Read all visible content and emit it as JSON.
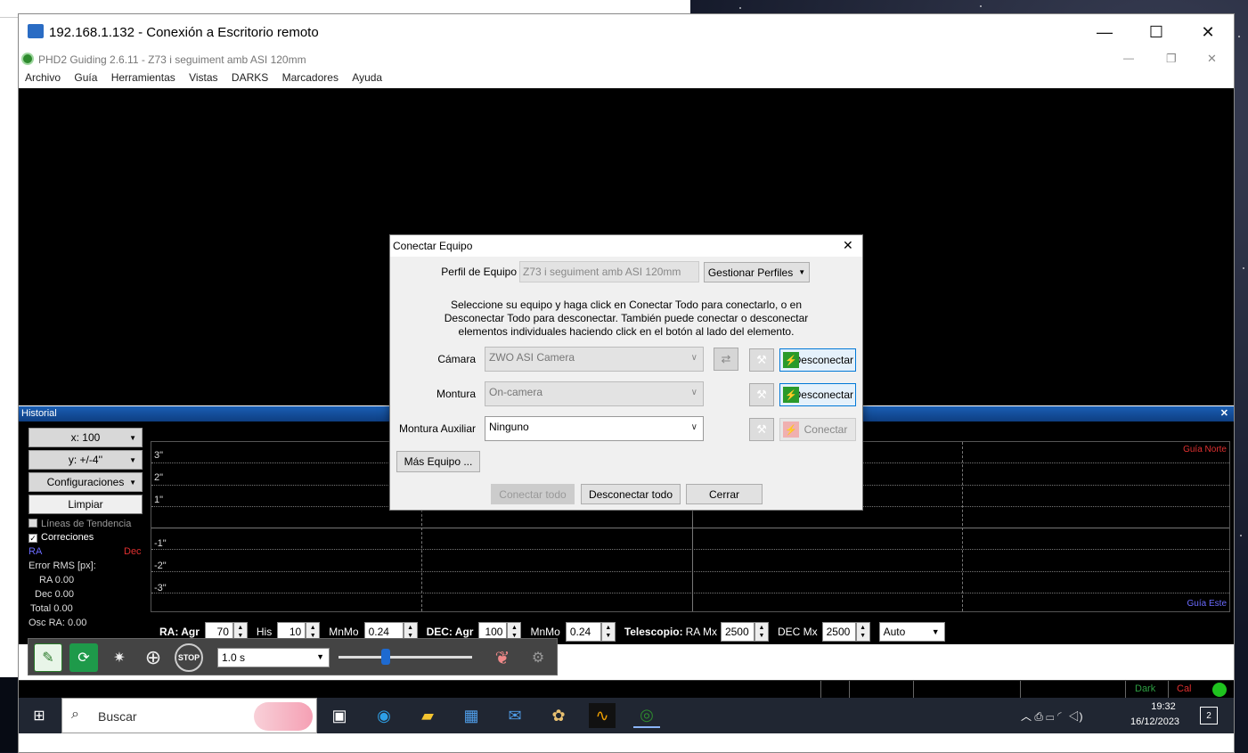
{
  "rdp": {
    "title": "192.168.1.132 - Conexión a Escritorio remoto",
    "minimize": "—",
    "maximize": "☐",
    "close": "✕"
  },
  "phd": {
    "title": "PHD2 Guiding 2.6.11 - Z73 i seguiment amb ASI 120mm",
    "minimize": "—",
    "restore": "❐",
    "close": "✕"
  },
  "menu": [
    "Archivo",
    "Guía",
    "Herramientas",
    "Vistas",
    "DARKS",
    "Marcadores",
    "Ayuda"
  ],
  "history": {
    "title": "Historial",
    "close": "✕",
    "x_scale": "x: 100",
    "y_scale": "y: +/-4''",
    "settings": "Configuraciones",
    "clear": "Limpiar",
    "trend_lines": "Líneas de Tendencia",
    "corrections": "Correciones",
    "ra_label": "RA",
    "dec_label": "Dec",
    "rms_label": "Error RMS [px]:",
    "rms_ra": "RA 0.00",
    "rms_dec": "Dec 0.00",
    "rms_total": "Total 0.00",
    "osc_ra": "Osc RA: 0.00",
    "y_labels": [
      "3\"",
      "2\"",
      "1\"",
      "-1\"",
      "-2\"",
      "-3\""
    ],
    "guide_north": "Guía Norte",
    "guide_east": "Guía Este",
    "colors": {
      "ra": "#6b6bff",
      "dec": "#e03030",
      "north": "#e03030",
      "east": "#6b6bff"
    }
  },
  "controls": {
    "ra_agr_label": "RA: Agr",
    "ra_agr": "70",
    "his_label": "His",
    "his": "10",
    "mnmo_label": "MnMo",
    "mnmo": "0.24",
    "dec_agr_label": "DEC: Agr",
    "dec_agr": "100",
    "dec_mnmo_label": "MnMo",
    "dec_mnmo": "0.24",
    "tel_label": "Telescopio:",
    "ra_mx_label": "RA Mx",
    "ra_mx": "2500",
    "dec_mx_label": "DEC Mx",
    "dec_mx": "2500",
    "mode": "Auto"
  },
  "toolbar": {
    "exposure": "1.0 s",
    "stop": "STOP"
  },
  "status": {
    "dark": "Dark",
    "cal": "Cal"
  },
  "taskbar": {
    "search": "Buscar",
    "time": "19:32",
    "date": "16/12/2023",
    "notif": "2"
  },
  "dialog": {
    "title": "Conectar Equipo",
    "close": "✕",
    "profile_label": "Perfil de Equipo",
    "profile_value": "Z73 i seguiment amb ASI 120mm",
    "manage_profiles": "Gestionar Perfiles",
    "instructions": "Seleccione su equipo y haga click en Conectar Todo para conectarlo, o en Desconectar Todo para desconectar. También puede conectar o desconectar elementos individuales haciendo click en el botón al lado del elemento.",
    "camera_label": "Cámara",
    "camera_value": "ZWO ASI Camera",
    "camera_btn": "Desconectar",
    "mount_label": "Montura",
    "mount_value": "On-camera",
    "mount_btn": "Desconectar",
    "aux_label": "Montura Auxiliar",
    "aux_value": "Ninguno",
    "aux_btn": "Conectar",
    "more": "Más Equipo ...",
    "connect_all": "Conectar todo",
    "disconnect_all": "Desconectar todo",
    "close_btn": "Cerrar"
  }
}
